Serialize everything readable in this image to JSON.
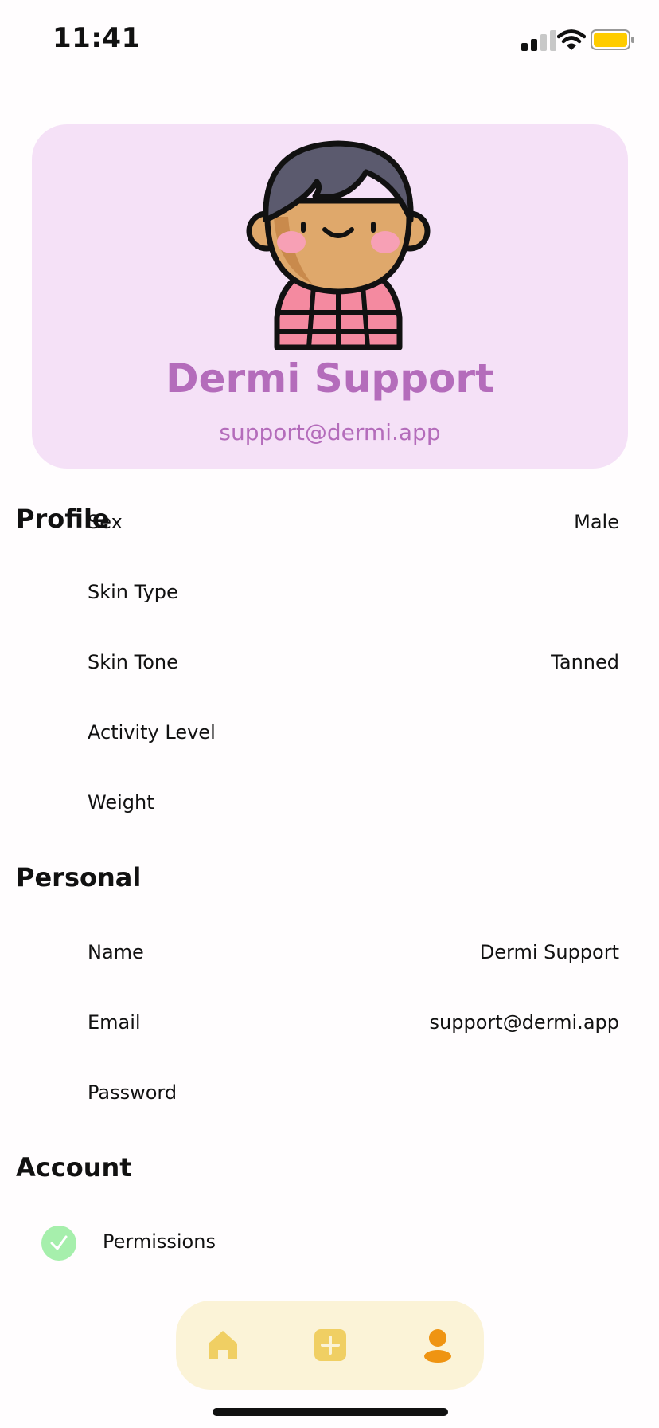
{
  "status_bar": {
    "time": "11:41"
  },
  "profile": {
    "name": "Dermi Support",
    "email": "support@dermi.app"
  },
  "sections": {
    "profile": {
      "title": "Profile",
      "rows": [
        {
          "label": "Sex",
          "value": "Male"
        },
        {
          "label": "Skin Type",
          "value": ""
        },
        {
          "label": "Skin Tone",
          "value": "Tanned"
        },
        {
          "label": "Activity Level",
          "value": ""
        },
        {
          "label": "Weight",
          "value": ""
        }
      ]
    },
    "personal": {
      "title": "Personal",
      "rows": [
        {
          "label": "Name",
          "value": "Dermi Support"
        },
        {
          "label": "Email",
          "value": "support@dermi.app"
        },
        {
          "label": "Password",
          "value": ""
        }
      ]
    },
    "account": {
      "title": "Account",
      "rows": [
        {
          "label": "Permissions",
          "status": "granted"
        }
      ]
    }
  },
  "tab_bar": {
    "tabs": [
      {
        "icon": "home-icon",
        "active": false
      },
      {
        "icon": "plus-square-icon",
        "active": false
      },
      {
        "icon": "person-icon",
        "active": true
      }
    ]
  },
  "colors": {
    "card_bg": "#f5e1f7",
    "accent_purple": "#b46cbb",
    "tab_bar_bg": "#fbf3d7",
    "tab_inactive": "#f0cf63",
    "tab_active": "#ef9412",
    "check_green": "#a6efac",
    "battery_yellow": "#ffcc00"
  }
}
